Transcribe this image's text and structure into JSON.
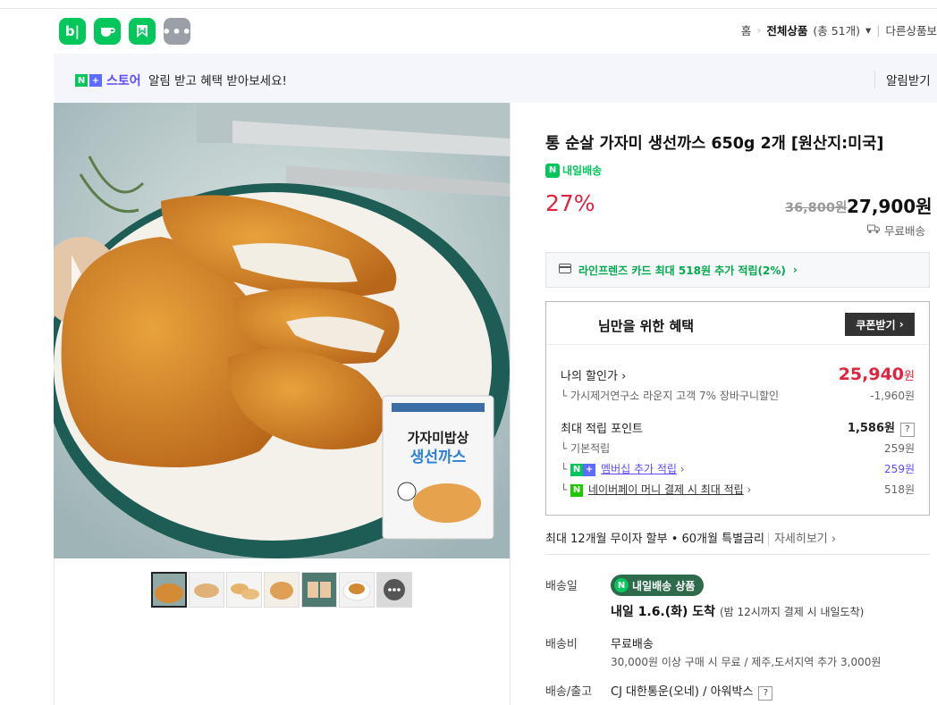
{
  "header": {
    "apps": [
      {
        "icon": "blog-icon",
        "glyph": "b|"
      },
      {
        "icon": "cafe-icon",
        "glyph": "☕"
      },
      {
        "icon": "bookmark-icon",
        "glyph": "◣"
      },
      {
        "icon": "more-apps-icon",
        "glyph": "•••"
      }
    ],
    "breadcrumb": {
      "home": "홈",
      "all_products": "전체상품",
      "count": "(총 51개)",
      "other": "다른상품보"
    }
  },
  "banner": {
    "store_label": "스토어",
    "message": "알림 받고 혜택 받아보세요!",
    "alarm_button": "알림받기"
  },
  "product": {
    "title": "통 순살 가자미 생선까스 650g 2개 [원산지:미국]",
    "delivery_badge": "내일배송",
    "discount_rate": "27%",
    "original_price": "36,800원",
    "price": "27,900원",
    "shipping": "무료배송",
    "card_benefit": "라인프렌즈 카드 최대 518원 추가 적립(2%)",
    "thumbnails": [
      "thumb-1",
      "thumb-2",
      "thumb-3",
      "thumb-4",
      "thumb-5",
      "thumb-6"
    ],
    "package_text": "가자미 밥상 생선까스"
  },
  "benefit": {
    "title": "님만을 위한 혜택",
    "coupon_button": "쿠폰받기",
    "my_price_label": "나의 할인가",
    "my_price": "25,940",
    "my_price_unit": "원",
    "discount_detail_label": "가시제거연구소 라운지 고객 7% 장바구니할인",
    "discount_detail_value": "-1,960원",
    "points_label": "최대 적립 포인트",
    "points_value": "1,586원",
    "basic_label": "기본적립",
    "basic_value": "259원",
    "membership_label": "멤버십 추가 적립",
    "membership_value": "259원",
    "npay_label": "네이버페이 머니 결제 시 최대 적립",
    "npay_value": "518원"
  },
  "installment": {
    "text": "최대 12개월 무이자 할부 • 60개월 특별금리",
    "detail": "자세히보기"
  },
  "delivery": {
    "date_label": "배송일",
    "pill": "내일배송 상품",
    "arrive": "내일 1.6.(화) 도착",
    "arrive_note": "(밤 12시까지 결제 시 내일도착)",
    "fee_label": "배송비",
    "fee_value": "무료배송",
    "fee_note": "30,000원 이상 구매 시 무료 / 제주,도서지역 추가 3,000원",
    "courier_label": "배송/출고",
    "courier_value": "CJ 대한통운(오네) / 아워박스"
  },
  "colors": {
    "naver_green": "#03c75a",
    "sale_red": "#e0243d",
    "store_purple": "#5b4cff"
  }
}
